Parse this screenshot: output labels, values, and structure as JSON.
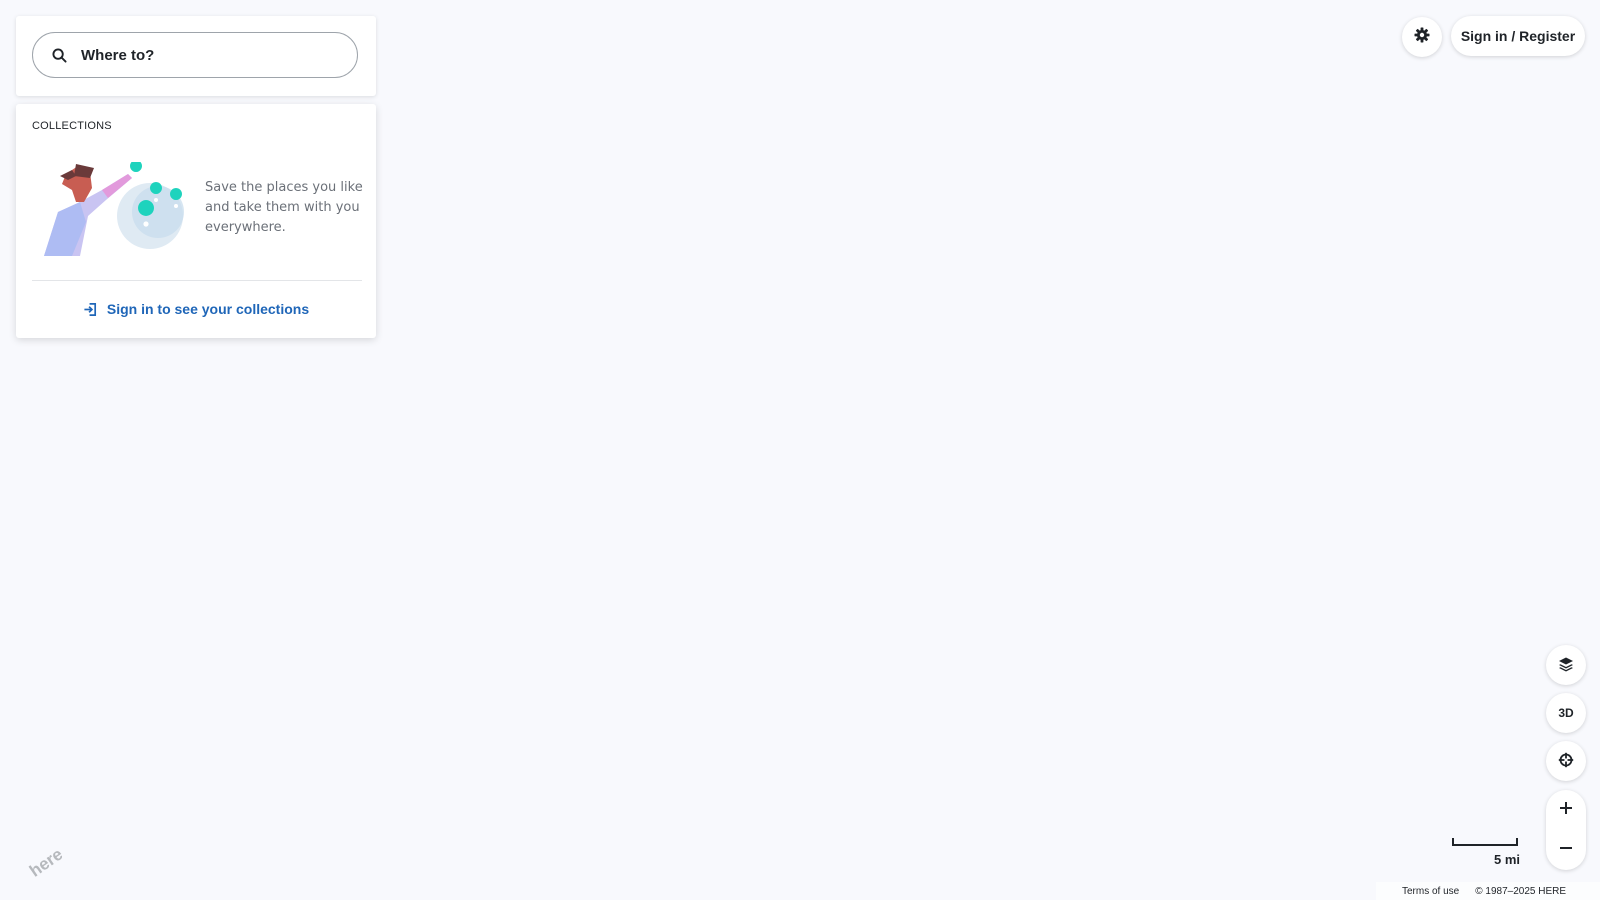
{
  "search": {
    "placeholder": "Where to?"
  },
  "collections": {
    "title": "COLLECTIONS",
    "promo_text": "Save the places you like and take them with you everywhere.",
    "signin_label": "Sign in to see your collections"
  },
  "header": {
    "signin_register_label": "Sign in / Register"
  },
  "map_controls": {
    "three_d_label": "3D"
  },
  "scale": {
    "label": "5 mi"
  },
  "footer": {
    "terms_label": "Terms of use",
    "copyright": "© 1987–2025 HERE"
  },
  "logo": {
    "text": "here"
  },
  "icons": {
    "search": "search-icon",
    "signin": "sign-in-icon",
    "settings": "gear-icon",
    "layers": "layers-icon",
    "locate": "crosshair-icon",
    "zoom_in": "plus-icon",
    "zoom_out": "minus-icon"
  },
  "colors": {
    "link": "#1f66b8",
    "text": "#1f2328",
    "map_background": "#f8f9fd"
  }
}
